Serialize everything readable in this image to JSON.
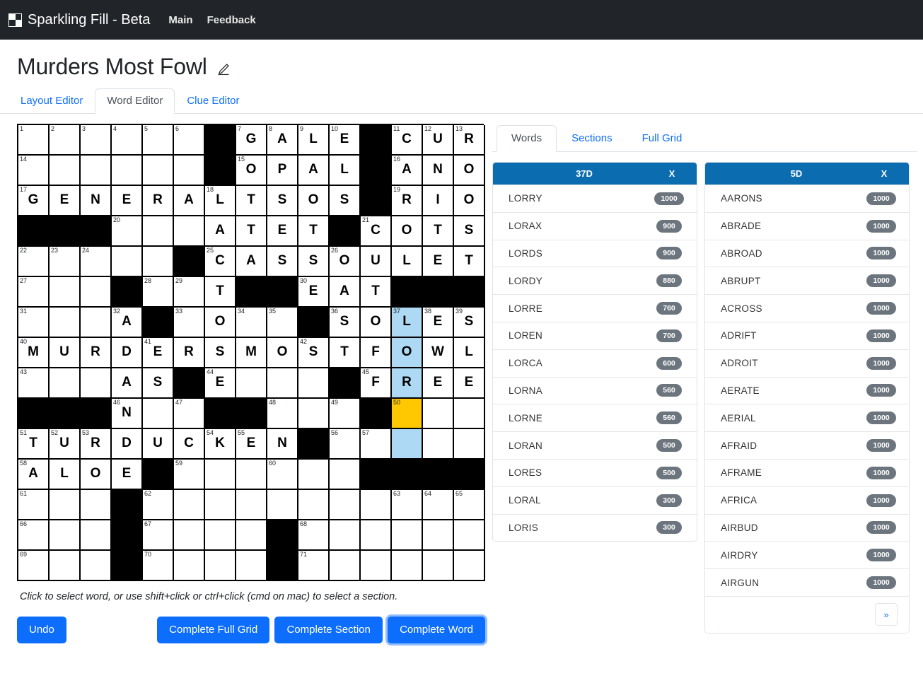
{
  "navbar": {
    "brand": "Sparkling Fill - Beta",
    "logo_icon": "checkerboard-icon",
    "links": [
      {
        "label": "Main"
      },
      {
        "label": "Feedback"
      }
    ]
  },
  "header": {
    "title": "Murders Most Fowl",
    "edit_icon": "edit-pencil-icon"
  },
  "tabs": [
    {
      "label": "Layout Editor",
      "active": false
    },
    {
      "label": "Word Editor",
      "active": true
    },
    {
      "label": "Clue Editor",
      "active": false
    }
  ],
  "grid": {
    "rows": 15,
    "cols": 15,
    "colors": {
      "block": "#000000",
      "selected_word": "#add9f4",
      "current_cell": "#ffc800",
      "empty": "#ffffff"
    },
    "cells": [
      [
        {
          "n": "1"
        },
        {
          "n": "2"
        },
        {
          "n": "3"
        },
        {
          "n": "4"
        },
        {
          "n": "5"
        },
        {
          "n": "6"
        },
        {
          "b": true
        },
        {
          "n": "7",
          "l": "G"
        },
        {
          "n": "8",
          "l": "A"
        },
        {
          "n": "9",
          "l": "L"
        },
        {
          "n": "10",
          "l": "E"
        },
        {
          "b": true
        },
        {
          "n": "11",
          "l": "C"
        },
        {
          "n": "12",
          "l": "U"
        },
        {
          "n": "13",
          "l": "R"
        }
      ],
      [
        {
          "n": "14"
        },
        {},
        {},
        {},
        {},
        {},
        {
          "b": true
        },
        {
          "n": "15",
          "l": "O"
        },
        {
          "l": "P"
        },
        {
          "l": "A"
        },
        {
          "l": "L"
        },
        {
          "b": true
        },
        {
          "n": "16",
          "l": "A"
        },
        {
          "l": "N"
        },
        {
          "l": "O"
        }
      ],
      [
        {
          "n": "17",
          "l": "G"
        },
        {
          "l": "E"
        },
        {
          "l": "N"
        },
        {
          "l": "E"
        },
        {
          "l": "R"
        },
        {
          "l": "A"
        },
        {
          "n": "18",
          "l": "L"
        },
        {
          "l": "T"
        },
        {
          "l": "S"
        },
        {
          "l": "O"
        },
        {
          "l": "S"
        },
        {
          "b": true
        },
        {
          "n": "19",
          "l": "R"
        },
        {
          "l": "I"
        },
        {
          "l": "O"
        }
      ],
      [
        {
          "b": true
        },
        {
          "b": true
        },
        {
          "b": true
        },
        {
          "n": "20"
        },
        {},
        {},
        {
          "l": "A"
        },
        {
          "l": "T"
        },
        {
          "l": "E"
        },
        {
          "l": "T"
        },
        {
          "b": true
        },
        {
          "n": "21",
          "l": "C"
        },
        {
          "l": "O"
        },
        {
          "l": "T"
        },
        {
          "l": "S"
        }
      ],
      [
        {
          "n": "22"
        },
        {
          "n": "23"
        },
        {
          "n": "24"
        },
        {},
        {},
        {
          "b": true
        },
        {
          "n": "25",
          "l": "C"
        },
        {
          "l": "A"
        },
        {
          "l": "S"
        },
        {
          "l": "S"
        },
        {
          "n": "26",
          "l": "O"
        },
        {
          "l": "U"
        },
        {
          "l": "L"
        },
        {
          "l": "E"
        },
        {
          "l": "T"
        }
      ],
      [
        {
          "n": "27"
        },
        {},
        {},
        {
          "b": true
        },
        {
          "n": "28"
        },
        {
          "n": "29"
        },
        {
          "l": "T"
        },
        {
          "b": true
        },
        {
          "b": true
        },
        {
          "n": "30",
          "l": "E"
        },
        {
          "l": "A"
        },
        {
          "l": "T"
        },
        {
          "b": true
        },
        {
          "b": true
        },
        {
          "b": true
        }
      ],
      [
        {
          "n": "31"
        },
        {},
        {},
        {
          "n": "32",
          "l": "A"
        },
        {
          "b": true
        },
        {
          "n": "33"
        },
        {
          "l": "O"
        },
        {
          "n": "34"
        },
        {
          "n": "35"
        },
        {
          "b": true
        },
        {
          "n": "36",
          "l": "S"
        },
        {
          "l": "O"
        },
        {
          "n": "37",
          "l": "L",
          "sel": true
        },
        {
          "n": "38",
          "l": "E"
        },
        {
          "n": "39",
          "l": "S"
        }
      ],
      [
        {
          "n": "40",
          "l": "M"
        },
        {
          "l": "U"
        },
        {
          "l": "R"
        },
        {
          "l": "D"
        },
        {
          "n": "41",
          "l": "E"
        },
        {
          "l": "R"
        },
        {
          "l": "S"
        },
        {
          "l": "M"
        },
        {
          "l": "O"
        },
        {
          "n": "42",
          "l": "S"
        },
        {
          "l": "T"
        },
        {
          "l": "F"
        },
        {
          "l": "O",
          "sel": true
        },
        {
          "l": "W"
        },
        {
          "l": "L"
        }
      ],
      [
        {
          "n": "43"
        },
        {},
        {},
        {
          "l": "A"
        },
        {
          "l": "S"
        },
        {
          "b": true
        },
        {
          "n": "44",
          "l": "E"
        },
        {},
        {},
        {},
        {
          "b": true
        },
        {
          "n": "45",
          "l": "F"
        },
        {
          "l": "R",
          "sel": true
        },
        {
          "l": "E"
        },
        {
          "l": "E"
        }
      ],
      [
        {
          "b": true
        },
        {
          "b": true
        },
        {
          "b": true
        },
        {
          "n": "46",
          "l": "N"
        },
        {},
        {
          "n": "47"
        },
        {
          "b": true
        },
        {
          "b": true
        },
        {
          "n": "48"
        },
        {},
        {
          "n": "49"
        },
        {
          "b": true
        },
        {
          "n": "50",
          "cur": true
        },
        {},
        {}
      ],
      [
        {
          "n": "51",
          "l": "T"
        },
        {
          "n": "52",
          "l": "U"
        },
        {
          "n": "53",
          "l": "R"
        },
        {
          "l": "D"
        },
        {
          "l": "U"
        },
        {
          "l": "C"
        },
        {
          "n": "54",
          "l": "K"
        },
        {
          "n": "55",
          "l": "E"
        },
        {
          "l": "N"
        },
        {
          "b": true
        },
        {
          "n": "56"
        },
        {
          "n": "57"
        },
        {
          "sel": true
        },
        {},
        {}
      ],
      [
        {
          "n": "58",
          "l": "A"
        },
        {
          "l": "L"
        },
        {
          "l": "O"
        },
        {
          "l": "E"
        },
        {
          "b": true
        },
        {
          "n": "59"
        },
        {},
        {},
        {
          "n": "60"
        },
        {},
        {},
        {
          "b": true
        },
        {
          "b": true
        },
        {
          "b": true
        },
        {
          "b": true
        }
      ],
      [
        {
          "n": "61"
        },
        {},
        {},
        {
          "b": true
        },
        {
          "n": "62"
        },
        {},
        {},
        {},
        {},
        {},
        {},
        {},
        {
          "n": "63"
        },
        {
          "n": "64"
        },
        {
          "n": "65"
        }
      ],
      [
        {
          "n": "66"
        },
        {},
        {},
        {
          "b": true
        },
        {
          "n": "67"
        },
        {},
        {},
        {},
        {
          "b": true
        },
        {
          "n": "68"
        },
        {},
        {},
        {},
        {},
        {}
      ],
      [
        {
          "n": "69"
        },
        {},
        {},
        {
          "b": true
        },
        {
          "n": "70"
        },
        {},
        {},
        {},
        {
          "b": true
        },
        {
          "n": "71"
        },
        {},
        {},
        {},
        {},
        {}
      ]
    ]
  },
  "hint_text": "Click to select word, or use shift+click or ctrl+click (cmd on mac) to select a section.",
  "buttons": {
    "undo": "Undo",
    "complete_full_grid": "Complete Full Grid",
    "complete_section": "Complete Section",
    "complete_word": "Complete Word"
  },
  "right_tabs": [
    {
      "label": "Words",
      "active": true
    },
    {
      "label": "Sections",
      "active": false
    },
    {
      "label": "Full Grid",
      "active": false
    }
  ],
  "wordlists": [
    {
      "header_label": "37D",
      "header_x": "X",
      "rows": [
        {
          "word": "LORRY",
          "score": "1000"
        },
        {
          "word": "LORAX",
          "score": "900"
        },
        {
          "word": "LORDS",
          "score": "900"
        },
        {
          "word": "LORDY",
          "score": "880"
        },
        {
          "word": "LORRE",
          "score": "760"
        },
        {
          "word": "LOREN",
          "score": "700"
        },
        {
          "word": "LORCA",
          "score": "600"
        },
        {
          "word": "LORNA",
          "score": "560"
        },
        {
          "word": "LORNE",
          "score": "560"
        },
        {
          "word": "LORAN",
          "score": "500"
        },
        {
          "word": "LORES",
          "score": "500"
        },
        {
          "word": "LORAL",
          "score": "300"
        },
        {
          "word": "LORIS",
          "score": "300"
        }
      ],
      "has_pager": false,
      "pager_label": ""
    },
    {
      "header_label": "5D",
      "header_x": "X",
      "rows": [
        {
          "word": "AARONS",
          "score": "1000"
        },
        {
          "word": "ABRADE",
          "score": "1000"
        },
        {
          "word": "ABROAD",
          "score": "1000"
        },
        {
          "word": "ABRUPT",
          "score": "1000"
        },
        {
          "word": "ACROSS",
          "score": "1000"
        },
        {
          "word": "ADRIFT",
          "score": "1000"
        },
        {
          "word": "ADROIT",
          "score": "1000"
        },
        {
          "word": "AERATE",
          "score": "1000"
        },
        {
          "word": "AERIAL",
          "score": "1000"
        },
        {
          "word": "AFRAID",
          "score": "1000"
        },
        {
          "word": "AFRAME",
          "score": "1000"
        },
        {
          "word": "AFRICA",
          "score": "1000"
        },
        {
          "word": "AIRBUD",
          "score": "1000"
        },
        {
          "word": "AIRDRY",
          "score": "1000"
        },
        {
          "word": "AIRGUN",
          "score": "1000"
        }
      ],
      "has_pager": true,
      "pager_label": "»"
    }
  ]
}
